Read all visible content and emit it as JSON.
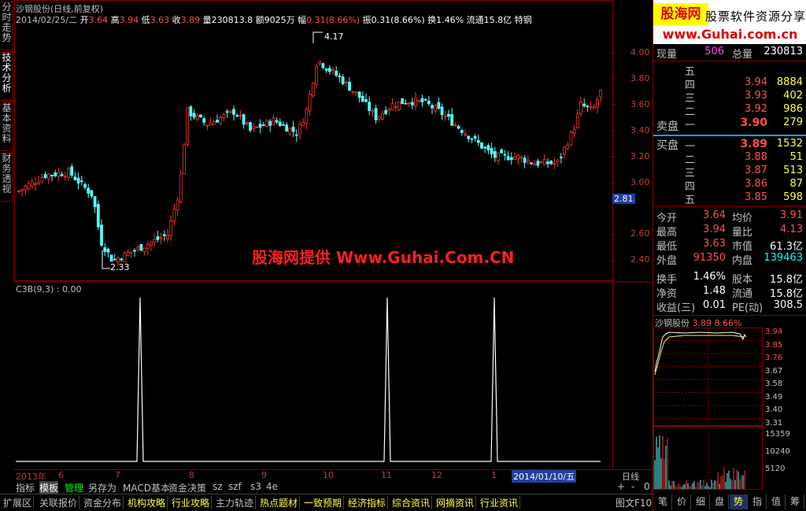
{
  "left_tabs": [
    "分时走势",
    "技术分析",
    "基本资料",
    "财务透视"
  ],
  "chart": {
    "title": "沙钢股份(日线,前复权)",
    "info": {
      "date": "2014/02/25/二",
      "open_label": "开",
      "open": "3.64",
      "high_label": "高",
      "high": "3.94",
      "low_label": "低",
      "low": "3.63",
      "close_label": "收",
      "close": "3.89",
      "vol_label": "量",
      "vol": "230813.8",
      "amt_label": "额",
      "amt": "9025万",
      "chg_label": "幅",
      "chg": "0.31(8.66%)",
      "amp_label": "振",
      "amp": "0.31(8.66%)",
      "turn_label": "换",
      "turn": "1.46%",
      "float_label": "流通",
      "float": "15.8亿",
      "special": "特钢"
    },
    "price_axis": [
      "4.00",
      "3.80",
      "3.60",
      "3.40",
      "3.20",
      "3.00",
      "2.81",
      "2.60",
      "2.40"
    ],
    "high_mark": "4.17",
    "low_mark": "2.33",
    "watermark": "股海网提供 Www.Guhai.Com.CN",
    "indicator_label": "C3B(9,3) : 0.00",
    "date_axis": [
      "2013年",
      "6",
      "7",
      "8",
      "9",
      "10",
      "11",
      "12",
      "1"
    ],
    "selected_date": "2014/01/10/五",
    "period": "日线",
    "toolbar": [
      "指标",
      "模板",
      "管理",
      "另存为",
      "MACD基本",
      "资金决策",
      "sz",
      "szf",
      "s3",
      "4e"
    ],
    "toolbar_right": [
      "+",
      "-",
      "0"
    ]
  },
  "nav_bar": [
    "扩展区",
    "关联报价",
    "资金分布",
    "机构攻略",
    "行业攻略",
    "主力轨迹",
    "热点题材",
    "一致预期",
    "经济指标",
    "综合资讯",
    "网摘资讯",
    "行业资讯"
  ],
  "nav_right": "图文F10",
  "right_panel": {
    "logo_main": "股海网",
    "logo_sub": "股票软件资源分享",
    "logo_url": "www.Guhai.com.cn",
    "xianliang_label": "现量",
    "xianliang": "506",
    "zongliang_label": "总量",
    "zongliang": "230813",
    "sell_label": "卖盘",
    "buy_label": "买盘",
    "asks": [
      {
        "level": "五",
        "price": "",
        "vol": ""
      },
      {
        "level": "四",
        "price": "3.94",
        "vol": "8884"
      },
      {
        "level": "三",
        "price": "3.93",
        "vol": "402"
      },
      {
        "level": "二",
        "price": "3.92",
        "vol": "986"
      },
      {
        "level": "一",
        "price": "3.90",
        "vol": "279"
      }
    ],
    "bids": [
      {
        "level": "一",
        "price": "3.89",
        "vol": "1532"
      },
      {
        "level": "二",
        "price": "3.88",
        "vol": "51"
      },
      {
        "level": "三",
        "price": "3.87",
        "vol": "513"
      },
      {
        "level": "四",
        "price": "3.86",
        "vol": "87"
      },
      {
        "level": "五",
        "price": "3.85",
        "vol": "598"
      }
    ],
    "stats": [
      {
        "l1": "今开",
        "v1": "3.64",
        "l2": "均价",
        "v2": "3.91"
      },
      {
        "l1": "最高",
        "v1": "3.94",
        "l2": "量比",
        "v2": "4.13"
      },
      {
        "l1": "最低",
        "v1": "3.63",
        "l2": "市值",
        "v2": "61.3亿"
      },
      {
        "l1": "外盘",
        "v1": "91350",
        "l2": "内盘",
        "v2": "139463"
      },
      {
        "l1": "换手",
        "v1": "1.46%",
        "l2": "股本",
        "v2": "15.8亿"
      },
      {
        "l1": "净资",
        "v1": "1.48",
        "l2": "流通",
        "v2": "15.8亿"
      },
      {
        "l1": "收益(三)",
        "v1": "0.01",
        "l2": "PE(动)",
        "v2": "308.5"
      }
    ],
    "mini_title": "沙钢股份",
    "mini_price": "3.89",
    "mini_chg": "8.66%",
    "mini_prices": [
      "3.94",
      "3.85",
      "3.76",
      "3.67",
      "3.58",
      "3.49",
      "3.40",
      "3.31"
    ],
    "mini_vols": [
      "15359",
      "10240",
      "5120"
    ],
    "tabs": [
      "笔",
      "价",
      "细",
      "盘",
      "势",
      "指",
      "值",
      "筹"
    ]
  },
  "colors": {
    "up": "#ff3030",
    "down": "#54ffff",
    "border": "#8b0000",
    "accent": "#ffff40"
  }
}
